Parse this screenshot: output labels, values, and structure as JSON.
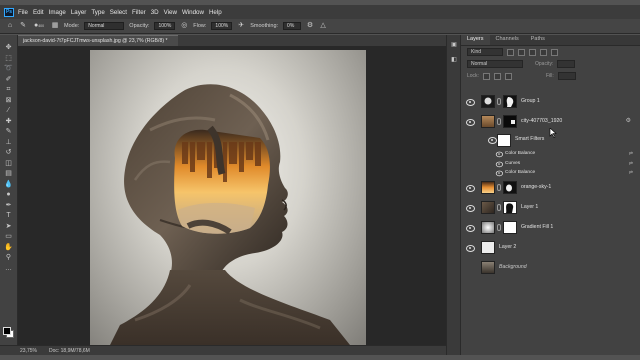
{
  "menu": {
    "logo": "Ps",
    "items": [
      "File",
      "Edit",
      "Image",
      "Layer",
      "Type",
      "Select",
      "Filter",
      "3D",
      "View",
      "Window",
      "Help"
    ]
  },
  "options": {
    "brush_size": "400",
    "mode_label": "Mode:",
    "mode_value": "Normal",
    "opacity_label": "Opacity:",
    "opacity_value": "100%",
    "flow_label": "Flow:",
    "flow_value": "100%",
    "smoothing_label": "Smoothing:",
    "smoothing_value": "0%"
  },
  "document": {
    "tab_title": "jackson-david-7t7pFCJTmws-unsplash.jpg @ 23,7% (RGB/8) *"
  },
  "status": {
    "zoom": "23,75%",
    "doc_info": "Doc: 18,9M/78,6M"
  },
  "layers_panel": {
    "tabs": [
      "Layers",
      "Channels",
      "Paths"
    ],
    "filter_kind": "Kind",
    "blend_mode": "Normal",
    "opacity_label": "Opacity:",
    "lock_label": "Lock:",
    "fill_label": "Fill:",
    "layers": [
      {
        "name": "Group 1",
        "visible": true
      },
      {
        "name": "city-407703_1920",
        "visible": true
      },
      {
        "name": "Smart Filters",
        "visible": true
      },
      {
        "name": "orange-sky-1",
        "visible": true
      },
      {
        "name": "Layer 1",
        "visible": true
      },
      {
        "name": "Gradient Fill 1",
        "visible": true
      },
      {
        "name": "Layer 2",
        "visible": true
      },
      {
        "name": "Background",
        "visible": false
      }
    ],
    "smart_filters": [
      "Color Balance",
      "Curves",
      "Color Balance"
    ]
  },
  "colors": {
    "accent": "#31a8ff",
    "panel_bg": "#424242",
    "canvas_bg": "#282828",
    "sky_orange": "#e08a2a"
  }
}
